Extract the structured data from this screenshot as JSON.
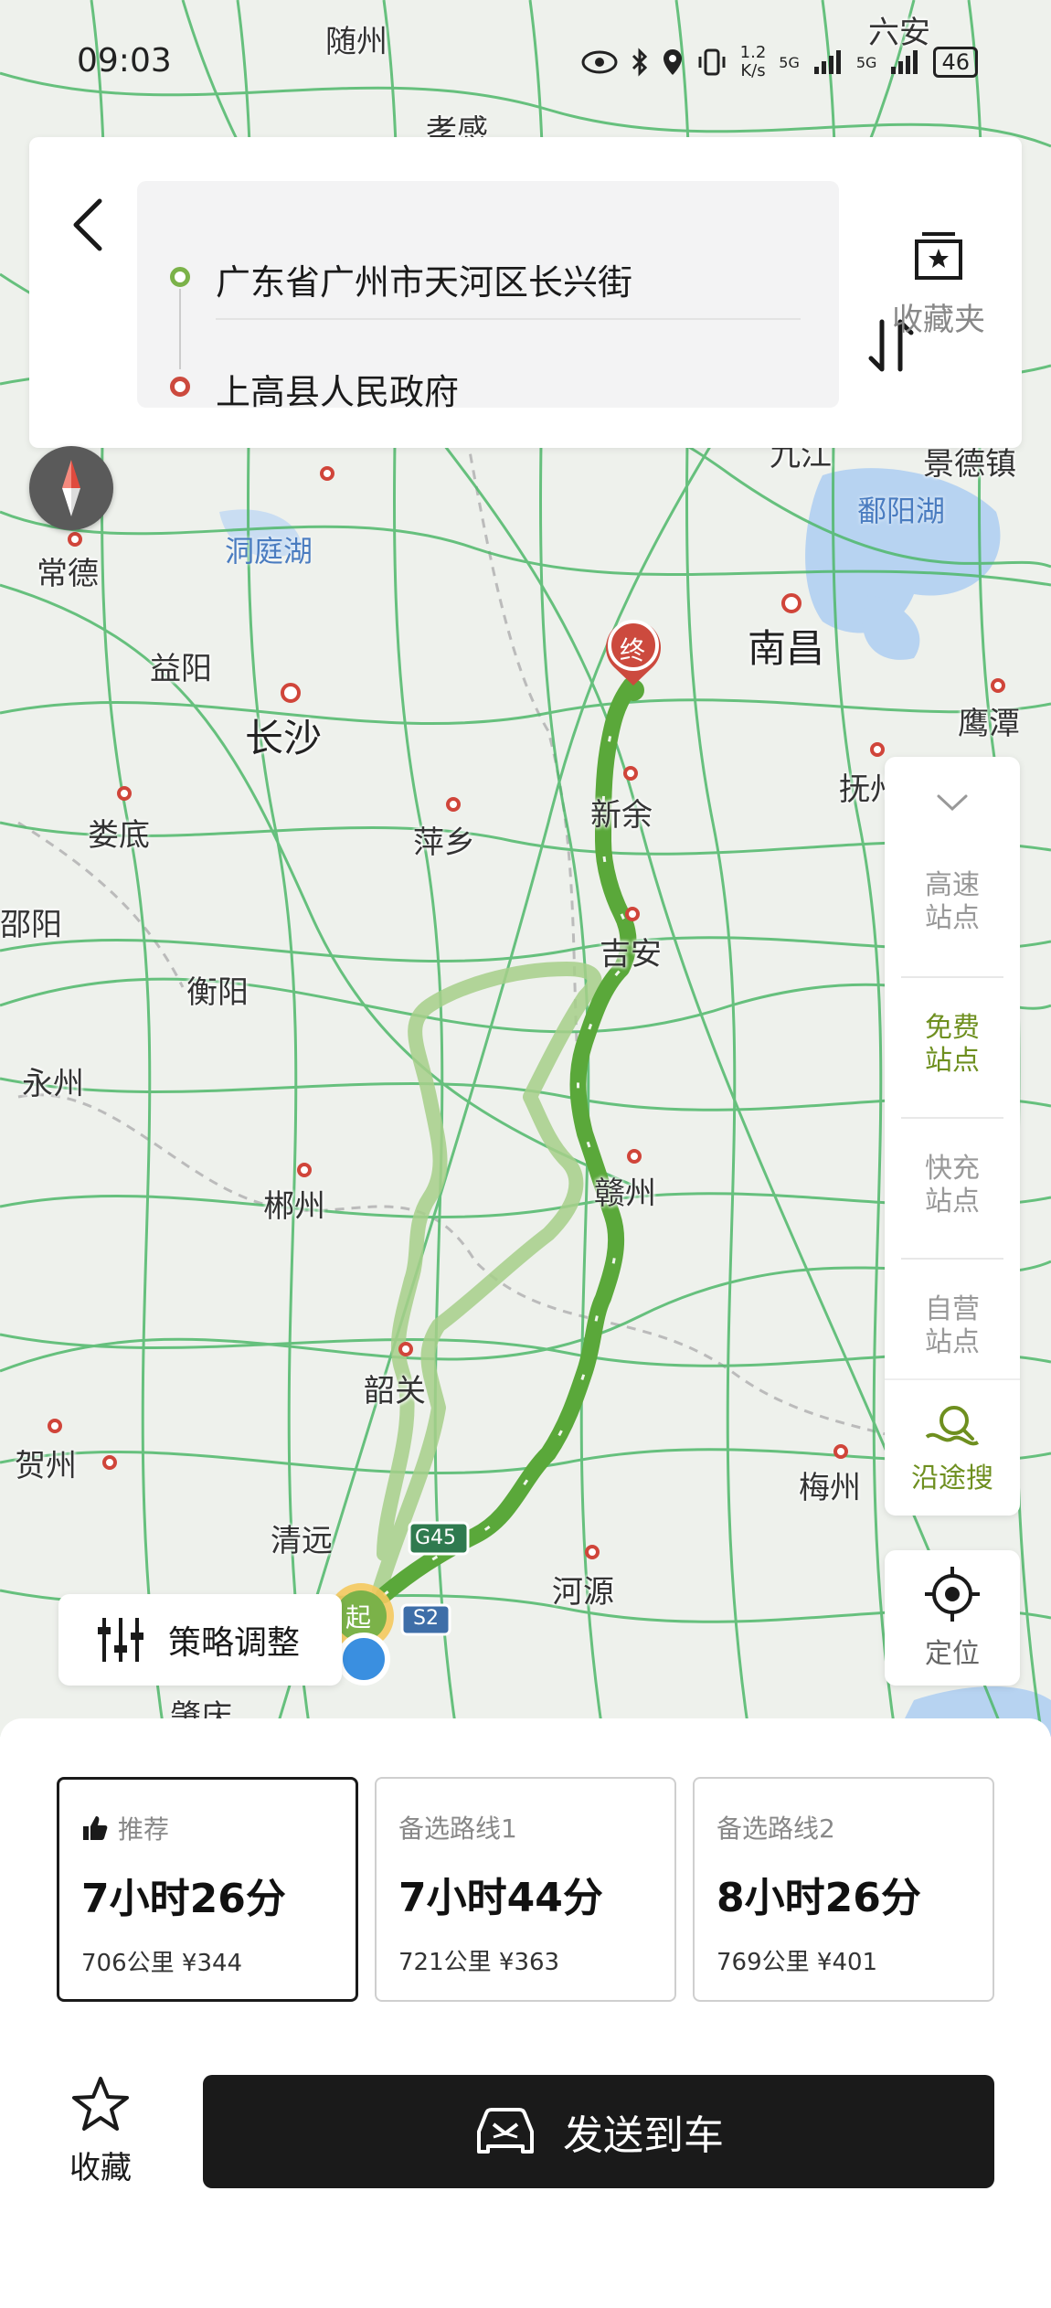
{
  "status_bar": {
    "time": "09:03",
    "net_speed_value": "1.2",
    "net_speed_unit": "K/s",
    "signal1_label": "5G",
    "signal2_label": "5G",
    "battery": "46"
  },
  "route_header": {
    "origin": "广东省广州市天河区长兴街",
    "destination": "上高县人民政府",
    "favorites_folder_label": "收藏夹"
  },
  "map": {
    "cities": {
      "suizhou": "随州",
      "xiaogan": "孝感",
      "luan": "六安",
      "changde": "常德",
      "dongtinghu": "洞庭湖",
      "yiyang": "益阳",
      "changsha": "长沙",
      "loudi": "娄底",
      "shaoyang": "邵阳",
      "hengyang": "衡阳",
      "yongzhou": "永州",
      "pingxiang": "萍乡",
      "xinyu": "新余",
      "nanchang": "南昌",
      "poyanghu": "鄱阳湖",
      "jiujiang": "九江",
      "jingdezhen": "景德镇",
      "yingtan": "鹰潭",
      "fuzhou": "抚州",
      "jian": "吉安",
      "ganzhou": "赣州",
      "chenzhou": "郴州",
      "shaoguan": "韶关",
      "hezhou": "贺州",
      "qingyuan": "清远",
      "heyuan": "河源",
      "meizhou": "梅州",
      "zhaoqing": "肇庆"
    },
    "start_marker": "起",
    "end_marker": "终",
    "highway_g45": "G45",
    "highway_s2": "S2",
    "colors": {
      "route_main": "#5aa83a",
      "route_alt": "#a6cf8a",
      "road": "#4fb86a",
      "start": "#7bb249",
      "end": "#cc4a3e"
    }
  },
  "side_panel": {
    "items": [
      {
        "line1": "高速",
        "line2": "站点",
        "active": false
      },
      {
        "line1": "免费",
        "line2": "站点",
        "active": true
      },
      {
        "line1": "快充",
        "line2": "站点",
        "active": false
      },
      {
        "line1": "自营",
        "line2": "站点",
        "active": false
      }
    ],
    "along_search_label": "沿途搜"
  },
  "locate_label": "定位",
  "strategy_label": "策略调整",
  "routes": [
    {
      "tag": "推荐",
      "time": "7小时26分",
      "distance": "706公里",
      "cost": "¥344",
      "selected": true
    },
    {
      "tag": "备选路线1",
      "time": "7小时44分",
      "distance": "721公里",
      "cost": "¥363",
      "selected": false
    },
    {
      "tag": "备选路线2",
      "time": "8小时26分",
      "distance": "769公里",
      "cost": "¥401",
      "selected": false
    }
  ],
  "favorite_label": "收藏",
  "send_to_car_label": "发送到车"
}
